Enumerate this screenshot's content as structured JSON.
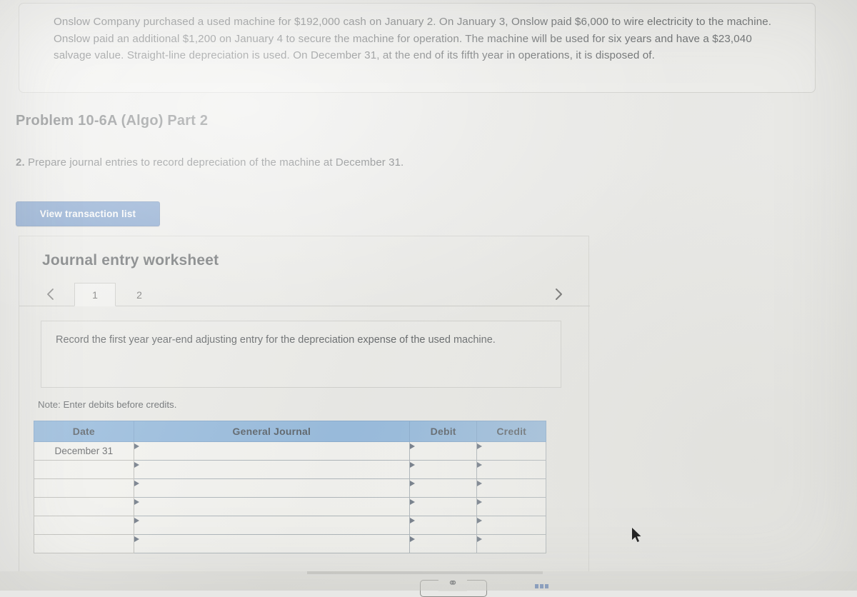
{
  "problem": {
    "statement": "Onslow Company purchased a used machine for $192,000 cash on January 2. On January 3, Onslow paid $6,000 to wire electricity to the machine. Onslow paid an additional $1,200 on January 4 to secure the machine for operation. The machine will be used for six years and have a $23,040 salvage value. Straight-line depreciation is used. On December 31, at the end of its fifth year in operations, it is disposed of."
  },
  "heading": {
    "part_title": "Problem 10-6A (Algo) Part 2",
    "question_number": "2.",
    "question_text": " Prepare journal entries to record depreciation of the machine at December 31."
  },
  "toolbar": {
    "view_transaction_list_label": "View transaction list"
  },
  "worksheet": {
    "title": "Journal entry worksheet",
    "prev_arrow": "‹",
    "next_arrow": "›",
    "tabs": [
      {
        "label": "1",
        "active": true
      },
      {
        "label": "2",
        "active": false
      }
    ],
    "instruction": "Record the first year year-end adjusting entry for the depreciation expense of the used machine.",
    "note": "Note: Enter debits before credits."
  },
  "journal_table": {
    "columns": [
      "Date",
      "General Journal",
      "Debit",
      "Credit"
    ],
    "rows": [
      {
        "date": "December 31",
        "general_journal": "",
        "debit": "",
        "credit": ""
      },
      {
        "date": "",
        "general_journal": "",
        "debit": "",
        "credit": ""
      },
      {
        "date": "",
        "general_journal": "",
        "debit": "",
        "credit": ""
      },
      {
        "date": "",
        "general_journal": "",
        "debit": "",
        "credit": ""
      },
      {
        "date": "",
        "general_journal": "",
        "debit": "",
        "credit": ""
      },
      {
        "date": "",
        "general_journal": "",
        "debit": "",
        "credit": ""
      }
    ]
  },
  "bottom_bar": {
    "link_icon_glyph": "⚭"
  },
  "colors": {
    "button_blue": "#3d71b7",
    "table_header_blue": "#6fa3d6",
    "page_background": "#e8e8e6",
    "dot_blue": "#3a63a8"
  }
}
